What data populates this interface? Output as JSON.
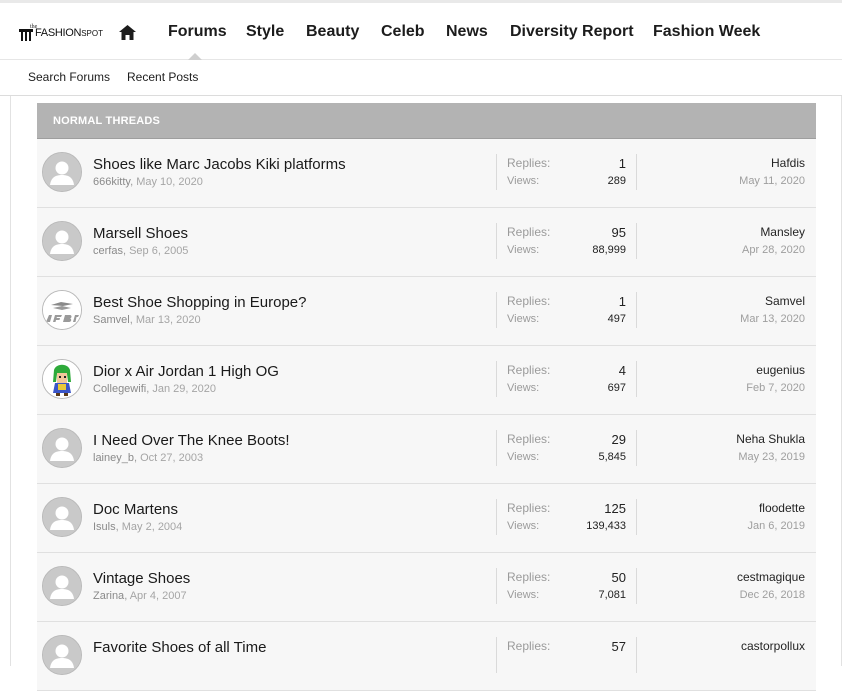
{
  "logo": {
    "the": "the",
    "main": "FASHION",
    "spot": "SPOT"
  },
  "nav": {
    "items": [
      "Forums",
      "Style",
      "Beauty",
      "Celeb",
      "News",
      "Diversity Report",
      "Fashion Week"
    ],
    "active": "Forums"
  },
  "subnav": {
    "search": "Search Forums",
    "recent": "Recent Posts"
  },
  "section": {
    "title": "NORMAL THREADS"
  },
  "labels": {
    "replies": "Replies:",
    "views": "Views:"
  },
  "threads": [
    {
      "title": "Shoes like Marc Jacobs Kiki platforms",
      "author": "666kitty",
      "start_date": "May 10, 2020",
      "replies": "1",
      "views": "289",
      "last_user": "Hafdis",
      "last_date": "May 11, 2020",
      "avatar": "default-avatar-icon"
    },
    {
      "title": "Marsell Shoes",
      "author": "cerfas",
      "start_date": "Sep 6, 2005",
      "replies": "95",
      "views": "88,999",
      "last_user": "Mansley",
      "last_date": "Apr 28, 2020",
      "avatar": "default-avatar-icon"
    },
    {
      "title": "Best Shoe Shopping in Europe?",
      "author": "Samvel",
      "start_date": "Mar 13, 2020",
      "replies": "1",
      "views": "497",
      "last_user": "Samvel",
      "last_date": "Mar 13, 2020",
      "avatar": "reebok-avatar-icon"
    },
    {
      "title": "Dior x Air Jordan 1 High OG",
      "author": "Collegewifi",
      "start_date": "Jan 29, 2020",
      "replies": "4",
      "views": "697",
      "last_user": "eugenius",
      "last_date": "Feb 7, 2020",
      "avatar": "cartoon-character-avatar-icon"
    },
    {
      "title": "I Need Over The Knee Boots!",
      "author": "lainey_b",
      "start_date": "Oct 27, 2003",
      "replies": "29",
      "views": "5,845",
      "last_user": "Neha Shukla",
      "last_date": "May 23, 2019",
      "avatar": "default-avatar-icon"
    },
    {
      "title": "Doc Martens",
      "author": "Isuls",
      "start_date": "May 2, 2004",
      "replies": "125",
      "views": "139,433",
      "last_user": "floodette",
      "last_date": "Jan 6, 2019",
      "avatar": "default-avatar-icon"
    },
    {
      "title": "Vintage Shoes",
      "author": "Zarina",
      "start_date": "Apr 4, 2007",
      "replies": "50",
      "views": "7,081",
      "last_user": "cestmagique",
      "last_date": "Dec 26, 2018",
      "avatar": "default-avatar-icon"
    },
    {
      "title": "Favorite Shoes of all Time",
      "author": "",
      "start_date": "",
      "replies": "57",
      "views": "",
      "last_user": "castorpollux",
      "last_date": "",
      "avatar": "default-avatar-icon"
    }
  ],
  "colors": {
    "header_bar": "#b3b3b3",
    "row_bg": "#f7f7f7",
    "muted_text": "#9a9a9a"
  }
}
